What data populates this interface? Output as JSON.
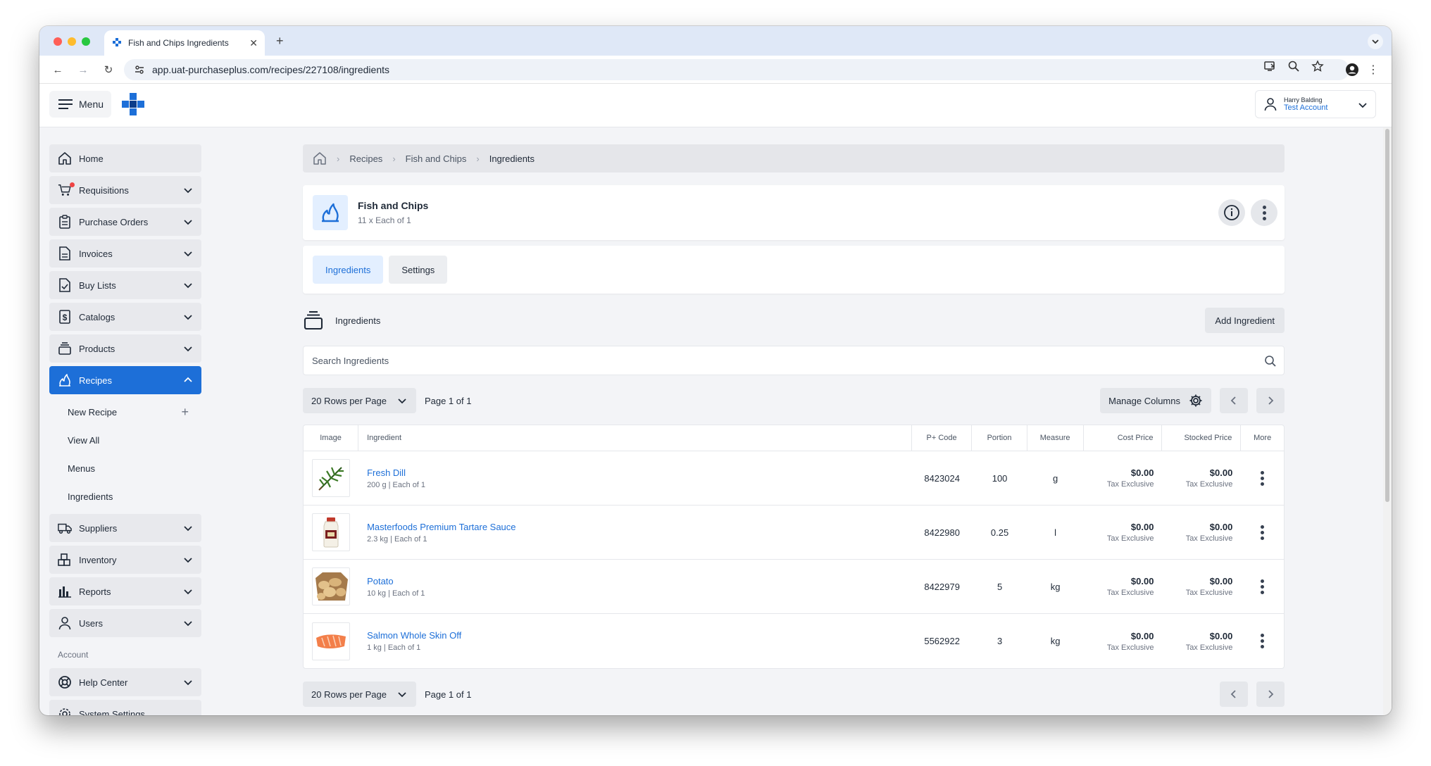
{
  "browser": {
    "tab_title": "Fish and Chips Ingredients",
    "url": "app.uat-purchaseplus.com/recipes/227108/ingredients"
  },
  "header": {
    "menu_label": "Menu",
    "user_name": "Harry Balding",
    "user_account": "Test Account"
  },
  "sidebar": {
    "items": [
      {
        "label": "Home",
        "icon": "home-icon"
      },
      {
        "label": "Requisitions",
        "icon": "cart-icon"
      },
      {
        "label": "Purchase Orders",
        "icon": "clipboard-icon"
      },
      {
        "label": "Invoices",
        "icon": "document-icon"
      },
      {
        "label": "Buy Lists",
        "icon": "checklist-icon"
      },
      {
        "label": "Catalogs",
        "icon": "dollar-icon"
      },
      {
        "label": "Products",
        "icon": "stack-icon"
      },
      {
        "label": "Recipes",
        "icon": "flame-icon"
      }
    ],
    "recipe_subitems": [
      "New Recipe",
      "View All",
      "Menus",
      "Ingredients"
    ],
    "items_after": [
      {
        "label": "Suppliers",
        "icon": "truck-icon"
      },
      {
        "label": "Inventory",
        "icon": "boxes-icon"
      },
      {
        "label": "Reports",
        "icon": "chart-icon"
      },
      {
        "label": "Users",
        "icon": "user-icon"
      }
    ],
    "account_section": "Account",
    "account_items": [
      {
        "label": "Help Center",
        "icon": "lifebuoy-icon"
      },
      {
        "label": "System Settings",
        "icon": "gear-icon"
      }
    ]
  },
  "breadcrumb": {
    "items": [
      "Recipes",
      "Fish and Chips",
      "Ingredients"
    ]
  },
  "recipe": {
    "title": "Fish and Chips",
    "subtitle": "11 x Each of 1"
  },
  "tabs": {
    "ingredients": "Ingredients",
    "settings": "Settings"
  },
  "section": {
    "title": "Ingredients",
    "add_label": "Add Ingredient"
  },
  "search": {
    "placeholder": "Search Ingredients"
  },
  "pager": {
    "rows_label": "20 Rows per Page",
    "page_label": "Page 1 of 1",
    "manage_label": "Manage Columns"
  },
  "table": {
    "headers": {
      "image": "Image",
      "ingredient": "Ingredient",
      "code": "P+ Code",
      "portion": "Portion",
      "measure": "Measure",
      "cost": "Cost Price",
      "stocked": "Stocked Price",
      "more": "More"
    },
    "rows": [
      {
        "name": "Fresh Dill",
        "sub": "200 g | Each of 1",
        "code": "8423024",
        "portion": "100",
        "measure": "g",
        "cost": "$0.00",
        "cost_sub": "Tax Exclusive",
        "stocked": "$0.00",
        "stocked_sub": "Tax Exclusive"
      },
      {
        "name": "Masterfoods Premium Tartare Sauce",
        "sub": "2.3 kg | Each of 1",
        "code": "8422980",
        "portion": "0.25",
        "measure": "l",
        "cost": "$0.00",
        "cost_sub": "Tax Exclusive",
        "stocked": "$0.00",
        "stocked_sub": "Tax Exclusive"
      },
      {
        "name": "Potato",
        "sub": "10 kg | Each of 1",
        "code": "8422979",
        "portion": "5",
        "measure": "kg",
        "cost": "$0.00",
        "cost_sub": "Tax Exclusive",
        "stocked": "$0.00",
        "stocked_sub": "Tax Exclusive"
      },
      {
        "name": "Salmon Whole Skin Off",
        "sub": "1 kg | Each of 1",
        "code": "5562922",
        "portion": "3",
        "measure": "kg",
        "cost": "$0.00",
        "cost_sub": "Tax Exclusive",
        "stocked": "$0.00",
        "stocked_sub": "Tax Exclusive"
      }
    ]
  },
  "colors": {
    "brand": "#1d6fd8",
    "sidebar_bg": "#e8e9ed",
    "page_bg": "#f3f4f7"
  }
}
